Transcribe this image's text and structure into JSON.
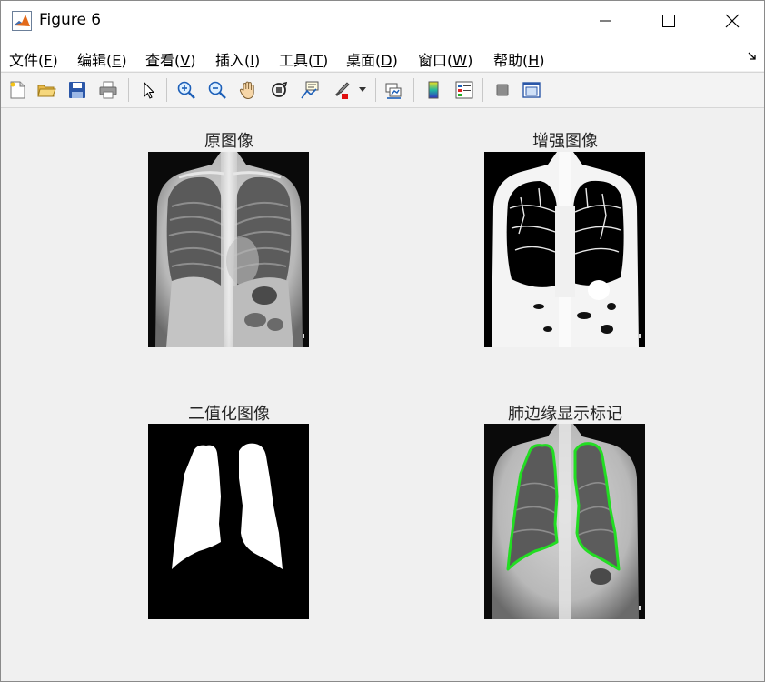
{
  "window": {
    "title": "Figure 6",
    "controls": {
      "minimize": "minimize",
      "maximize": "maximize",
      "close": "close"
    }
  },
  "menu": [
    {
      "label": "文件(",
      "key": "F",
      "end": ")"
    },
    {
      "label": "编辑(",
      "key": "E",
      "end": ")"
    },
    {
      "label": "查看(",
      "key": "V",
      "end": ")"
    },
    {
      "label": "插入(",
      "key": "I",
      "end": ")"
    },
    {
      "label": "工具(",
      "key": "T",
      "end": ")"
    },
    {
      "label": "桌面(",
      "key": "D",
      "end": ")"
    },
    {
      "label": "窗口(",
      "key": "W",
      "end": ")"
    },
    {
      "label": "帮助(",
      "key": "H",
      "end": ")"
    }
  ],
  "toolbar": {
    "icons": [
      "new-figure-icon",
      "open-icon",
      "save-icon",
      "print-icon",
      "pointer-icon",
      "zoom-in-icon",
      "zoom-out-icon",
      "pan-icon",
      "rotate-3d-icon",
      "data-cursor-icon",
      "brush-icon",
      "link-plot-icon",
      "colorbar-icon",
      "legend-icon",
      "hide-plot-tools-icon",
      "show-plot-tools-icon"
    ]
  },
  "subplots": [
    {
      "title": "原图像",
      "kind": "original"
    },
    {
      "title": "增强图像",
      "kind": "enhanced"
    },
    {
      "title": "二值化图像",
      "kind": "binary"
    },
    {
      "title": "肺边缘显示标记",
      "kind": "edges"
    }
  ],
  "colors": {
    "edge_marker": "#22dd22",
    "axes_background": "#000000",
    "figure_background": "#f0f0f0"
  }
}
